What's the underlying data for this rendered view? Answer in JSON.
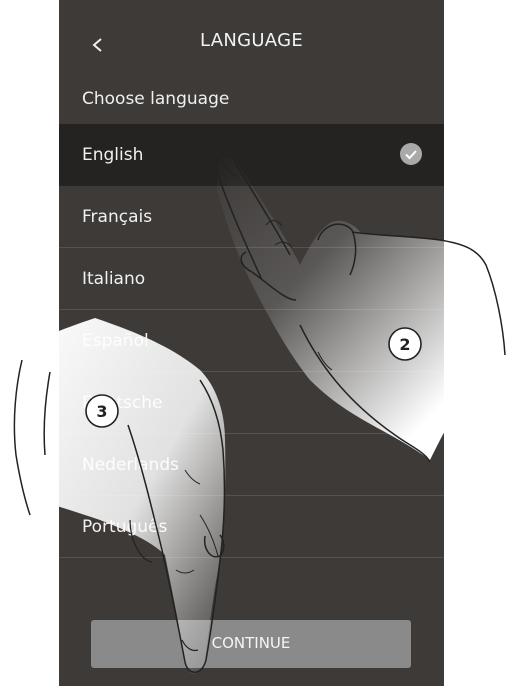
{
  "header": {
    "title": "LANGUAGE",
    "back_icon": "chevron-left-icon"
  },
  "subtitle": "Choose language",
  "languages": [
    {
      "label": "English",
      "selected": true
    },
    {
      "label": "Français",
      "selected": false
    },
    {
      "label": "Italiano",
      "selected": false
    },
    {
      "label": "Español",
      "selected": false
    },
    {
      "label": "Deutsche",
      "selected": false
    },
    {
      "label": "Nederlands",
      "selected": false
    },
    {
      "label": "Português",
      "selected": false
    }
  ],
  "continue_label": "CONTINUE",
  "steps": [
    "2",
    "3"
  ],
  "colors": {
    "screen_bg": "#3d3a38",
    "selected_row_bg": "#252321",
    "button_bg": "#8a8a8a",
    "check_bg": "#a9a9a9"
  }
}
